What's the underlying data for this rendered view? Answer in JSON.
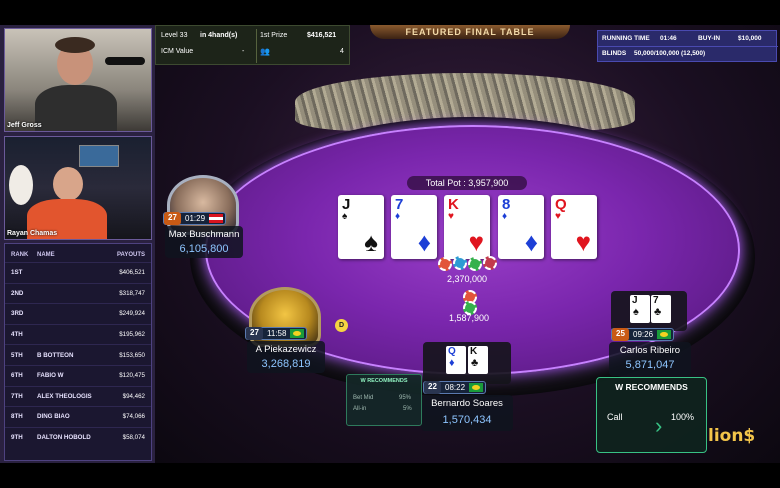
{
  "streams": [
    {
      "name": "Jeff Gross"
    },
    {
      "name": "Rayan Chamas"
    }
  ],
  "payouts": {
    "headers": {
      "rank": "RANK",
      "name": "NAME",
      "payouts": "PAYOUTS"
    },
    "rows": [
      {
        "rank": "1ST",
        "name": "",
        "amount": "$406,521"
      },
      {
        "rank": "2ND",
        "name": "",
        "amount": "$318,747"
      },
      {
        "rank": "3RD",
        "name": "",
        "amount": "$249,924"
      },
      {
        "rank": "4TH",
        "name": "",
        "amount": "$195,962"
      },
      {
        "rank": "5TH",
        "name": "B BOTTEON",
        "amount": "$153,650"
      },
      {
        "rank": "6TH",
        "name": "FABIO W",
        "amount": "$120,475"
      },
      {
        "rank": "7TH",
        "name": "ALEX THEOLOGIS",
        "amount": "$94,462"
      },
      {
        "rank": "8TH",
        "name": "DING BIAO",
        "amount": "$74,066"
      },
      {
        "rank": "9TH",
        "name": "DALTON HOBOLD",
        "amount": "$58,074"
      }
    ]
  },
  "hud": {
    "level": "Level 33",
    "hands": "in 4hand(s)",
    "icm_label": "ICM Value",
    "icm_value": "-",
    "first_prize_label": "1st Prize",
    "first_prize_value": "$416,521",
    "players_left": "4",
    "featured": "FEATURED FINAL TABLE",
    "running_time_label": "RUNNING TIME",
    "running_time_value": "01:46",
    "buyin_label": "BUY-IN",
    "buyin_value": "$10,000",
    "blinds_label": "BLINDS",
    "blinds_value": "50,000/100,000 (12,500)"
  },
  "table": {
    "total_pot": "Total Pot : 3,957,900",
    "main_pot": "2,370,000",
    "side_bet": "1,587,900",
    "dealer": "D",
    "board": [
      {
        "rank": "J",
        "suit": "♠",
        "color": "black"
      },
      {
        "rank": "7",
        "suit": "♦",
        "color": "blue"
      },
      {
        "rank": "K",
        "suit": "♥",
        "color": "red"
      },
      {
        "rank": "8",
        "suit": "♦",
        "color": "blue"
      },
      {
        "rank": "Q",
        "suit": "♥",
        "color": "red"
      }
    ]
  },
  "players": {
    "max": {
      "seat": "27",
      "timer": "01:29",
      "name": "Max Buschmann",
      "stack": "6,105,800"
    },
    "piek": {
      "seat": "27",
      "timer": "11:58",
      "name": "A Piekazewicz",
      "stack": "3,268,819"
    },
    "bern": {
      "seat": "22",
      "timer": "08:22",
      "name": "Bernardo Soares",
      "stack": "1,570,434",
      "cards": [
        {
          "rank": "Q",
          "suit": "♦",
          "color": "blue"
        },
        {
          "rank": "K",
          "suit": "♣",
          "color": "black"
        }
      ]
    },
    "carlos": {
      "seat": "25",
      "timer": "09:26",
      "name": "Carlos Ribeiro",
      "stack": "5,871,047",
      "cards": [
        {
          "rank": "J",
          "suit": "♠",
          "color": "black"
        },
        {
          "rank": "7",
          "suit": "♣",
          "color": "black"
        }
      ]
    }
  },
  "recommend_small": {
    "title": "W RECOMMENDS",
    "line1_label": "Bet Mid",
    "line1_pct": "95%",
    "line2_label": "All-in",
    "line2_pct": "5%"
  },
  "recommend_big": {
    "title": "W RECOMMENDS",
    "action": "Call",
    "pct": "100%"
  },
  "brand": "lion$"
}
